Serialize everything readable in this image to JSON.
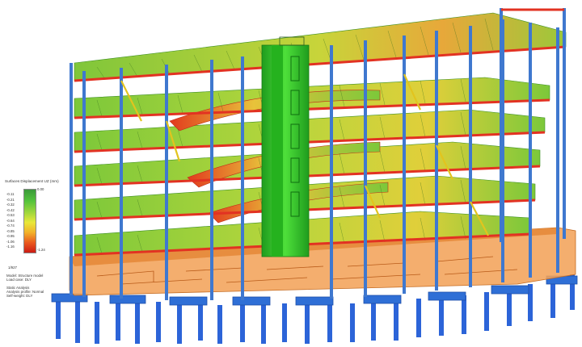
{
  "legend": {
    "title": "Surfaces Displacement UZ (mm)",
    "max_label": "0.00",
    "min_label": "-1.24",
    "ticks": [
      "-0.11",
      "-0.21",
      "-0.32",
      "-0.42",
      "-0.53",
      "-0.64",
      "-0.74",
      "-0.85",
      "-0.95",
      "-1.06",
      "-1.16"
    ],
    "view_label": "1/927",
    "model_lines": [
      "Model: Structure model",
      "Load case: DLY"
    ],
    "analysis_lines": [
      "Static Analysis",
      "Analysis profile: Normal",
      "Self-weight: DLY"
    ]
  },
  "colors": {
    "column_blue": "#3f78cf",
    "beam_red": "#e23222",
    "core_green": "#2ecc1e",
    "slab_green": "#84c83a",
    "slab_yellow": "#d9d63c",
    "basement_orange": "#f2a35a",
    "pile_blue": "#2c64d8"
  }
}
